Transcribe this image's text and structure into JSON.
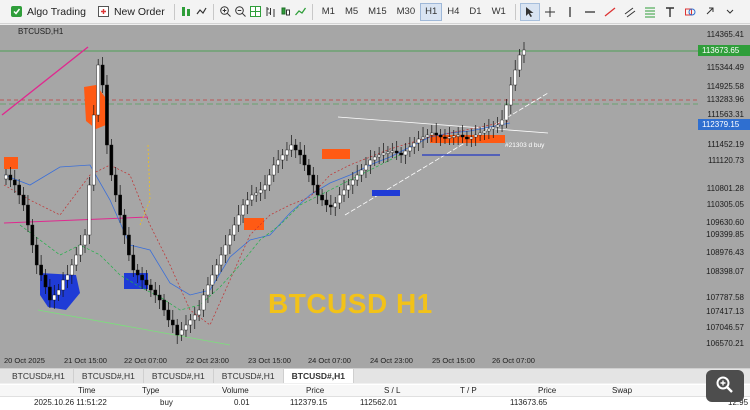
{
  "toolbar": {
    "algo_trading": "Algo Trading",
    "new_order": "New Order",
    "timeframes": [
      "M1",
      "M5",
      "M15",
      "M30",
      "H1",
      "H4",
      "D1",
      "W1"
    ],
    "active_timeframe": "H1"
  },
  "chart": {
    "symbol": "BTCUSD,H1",
    "watermark": "BTCUSD H1",
    "price_levels": [
      "114365.41",
      "115344.49",
      "114925.58",
      "113283.96",
      "111563.31",
      "111452.19",
      "111120.73",
      "110801.28",
      "110305.05",
      "109630.60",
      "109399.85",
      "108976.43",
      "108398.07",
      "107787.58",
      "107417.13",
      "107046.57",
      "106570.21"
    ],
    "bid_tag": "113673.65",
    "buy_tag": "112379.15",
    "time_labels": [
      "20 Oct 2025",
      "21 Oct 15:00",
      "22 Oct 07:00",
      "22 Oct 23:00",
      "23 Oct 15:00",
      "24 Oct 07:00",
      "24 Oct 23:00",
      "25 Oct 15:00",
      "26 Oct 07:00"
    ],
    "trade_line_label": "#21303 d buy",
    "colors": {
      "bg": "#a6a6a6",
      "bull": "#ffffff",
      "bear": "#000000",
      "accent": "#f2c219"
    }
  },
  "tabs": [
    "BTCUSD#,H1",
    "BTCUSD#,H1",
    "BTCUSD#,H1",
    "BTCUSD#,H1",
    "BTCUSD#,H1"
  ],
  "active_tab": 4,
  "trade": {
    "headers": {
      "time": "Time",
      "type": "Type",
      "volume": "Volume",
      "price": "Price",
      "sl": "S / L",
      "tp": "T / P",
      "price2": "Price",
      "swap": "Swap",
      "profit": "fit"
    },
    "row": {
      "time": "2025.10.26 11:51:22",
      "type": "buy",
      "volume": "0.01",
      "price": "112379.15",
      "sl": "112562.01",
      "tp": "",
      "price2": "113673.65",
      "swap": "",
      "profit": "12.95"
    }
  }
}
